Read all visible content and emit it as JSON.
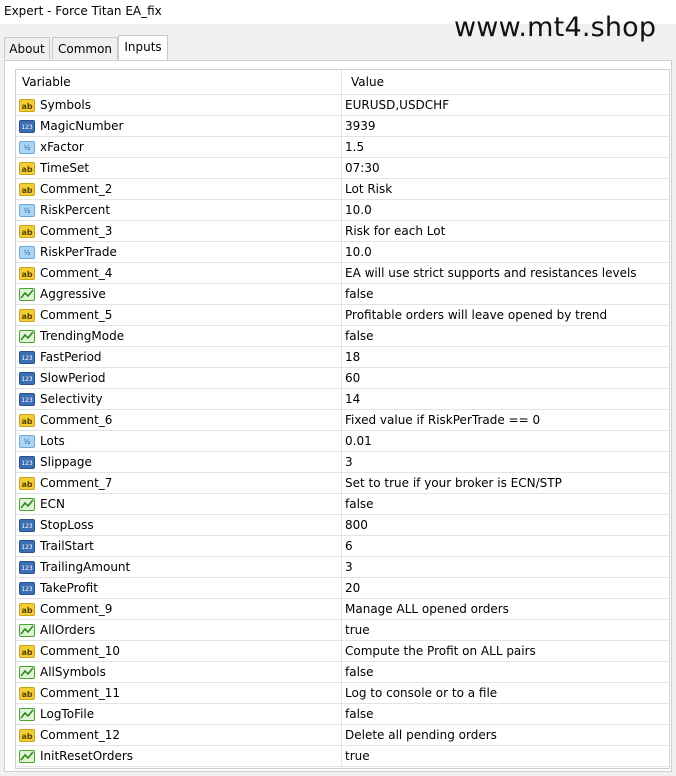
{
  "window": {
    "title": "Expert - Force Titan EA_fix"
  },
  "watermark": "www.mt4.shop",
  "tabs": [
    {
      "label": "About"
    },
    {
      "label": "Common"
    },
    {
      "label": "Inputs"
    }
  ],
  "table": {
    "headers": {
      "variable": "Variable",
      "value": "Value"
    },
    "rows": [
      {
        "name": "Symbols",
        "value": "EURUSD,USDCHF",
        "icon": "ab"
      },
      {
        "name": "MagicNumber",
        "value": "3939",
        "icon": "int"
      },
      {
        "name": "xFactor",
        "value": "1.5",
        "icon": "dbl"
      },
      {
        "name": "TimeSet",
        "value": "07:30",
        "icon": "ab"
      },
      {
        "name": "Comment_2",
        "value": "Lot Risk",
        "icon": "ab"
      },
      {
        "name": "RiskPercent",
        "value": "10.0",
        "icon": "dbl"
      },
      {
        "name": "Comment_3",
        "value": "Risk for each Lot",
        "icon": "ab"
      },
      {
        "name": "RiskPerTrade",
        "value": "10.0",
        "icon": "dbl"
      },
      {
        "name": "Comment_4",
        "value": "EA will use strict supports and resistances levels",
        "icon": "ab"
      },
      {
        "name": "Aggressive",
        "value": "false",
        "icon": "bool"
      },
      {
        "name": "Comment_5",
        "value": "Profitable orders will leave opened by trend",
        "icon": "ab"
      },
      {
        "name": "TrendingMode",
        "value": "false",
        "icon": "bool"
      },
      {
        "name": "FastPeriod",
        "value": "18",
        "icon": "int"
      },
      {
        "name": "SlowPeriod",
        "value": "60",
        "icon": "int"
      },
      {
        "name": "Selectivity",
        "value": "14",
        "icon": "int"
      },
      {
        "name": "Comment_6",
        "value": "Fixed value if RiskPerTrade == 0",
        "icon": "ab"
      },
      {
        "name": "Lots",
        "value": "0.01",
        "icon": "dbl"
      },
      {
        "name": "Slippage",
        "value": "3",
        "icon": "int"
      },
      {
        "name": "Comment_7",
        "value": "Set to true if your broker is ECN/STP",
        "icon": "ab"
      },
      {
        "name": "ECN",
        "value": "false",
        "icon": "bool"
      },
      {
        "name": "StopLoss",
        "value": "800",
        "icon": "int"
      },
      {
        "name": "TrailStart",
        "value": "6",
        "icon": "int"
      },
      {
        "name": "TrailingAmount",
        "value": "3",
        "icon": "int"
      },
      {
        "name": "TakeProfit",
        "value": "20",
        "icon": "int"
      },
      {
        "name": "Comment_9",
        "value": "Manage ALL opened orders",
        "icon": "ab"
      },
      {
        "name": "AllOrders",
        "value": "true",
        "icon": "bool"
      },
      {
        "name": "Comment_10",
        "value": "Compute the Profit on ALL pairs",
        "icon": "ab"
      },
      {
        "name": "AllSymbols",
        "value": "false",
        "icon": "bool"
      },
      {
        "name": "Comment_11",
        "value": "Log to console or to a file",
        "icon": "ab"
      },
      {
        "name": "LogToFile",
        "value": "false",
        "icon": "bool"
      },
      {
        "name": "Comment_12",
        "value": "Delete all pending orders",
        "icon": "ab"
      },
      {
        "name": "InitResetOrders",
        "value": "true",
        "icon": "bool"
      }
    ]
  }
}
